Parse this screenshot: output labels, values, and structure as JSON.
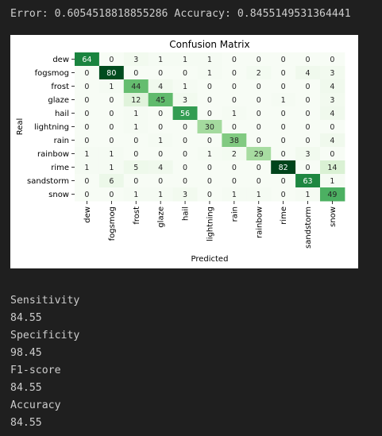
{
  "output": {
    "header_line": "Error: 0.6054518818855286 Accuracy: 0.8455149531364441",
    "metrics": [
      {
        "label": "Sensitivity",
        "value": "84.55"
      },
      {
        "label": "Specificity",
        "value": "98.45"
      },
      {
        "label": "F1-score",
        "value": "84.55"
      },
      {
        "label": "Accuracy",
        "value": "84.55"
      }
    ]
  },
  "chart_data": {
    "type": "heatmap",
    "title": "Confusion Matrix",
    "xlabel": "Predicted",
    "ylabel": "Real",
    "labels": [
      "dew",
      "fogsmog",
      "frost",
      "glaze",
      "hail",
      "lightning",
      "rain",
      "rainbow",
      "rime",
      "sandstorm",
      "snow"
    ],
    "matrix": [
      [
        64,
        0,
        3,
        1,
        1,
        1,
        0,
        0,
        0,
        0,
        0
      ],
      [
        0,
        80,
        0,
        0,
        0,
        1,
        0,
        2,
        0,
        4,
        3
      ],
      [
        0,
        1,
        44,
        4,
        1,
        0,
        0,
        0,
        0,
        0,
        4
      ],
      [
        0,
        0,
        12,
        45,
        3,
        0,
        0,
        0,
        1,
        0,
        3
      ],
      [
        0,
        0,
        1,
        0,
        56,
        0,
        1,
        0,
        0,
        0,
        4
      ],
      [
        0,
        0,
        1,
        0,
        0,
        30,
        0,
        0,
        0,
        0,
        0
      ],
      [
        0,
        0,
        0,
        1,
        0,
        0,
        38,
        0,
        0,
        0,
        4
      ],
      [
        1,
        1,
        0,
        0,
        0,
        1,
        2,
        29,
        0,
        3,
        0
      ],
      [
        1,
        1,
        5,
        4,
        0,
        0,
        0,
        0,
        82,
        0,
        14
      ],
      [
        0,
        6,
        0,
        0,
        0,
        0,
        0,
        0,
        0,
        63,
        1
      ],
      [
        0,
        0,
        1,
        1,
        3,
        0,
        1,
        1,
        0,
        1,
        49
      ]
    ],
    "colormap": "Greens",
    "vmin": 0,
    "vmax": 82,
    "colorbar": false
  }
}
